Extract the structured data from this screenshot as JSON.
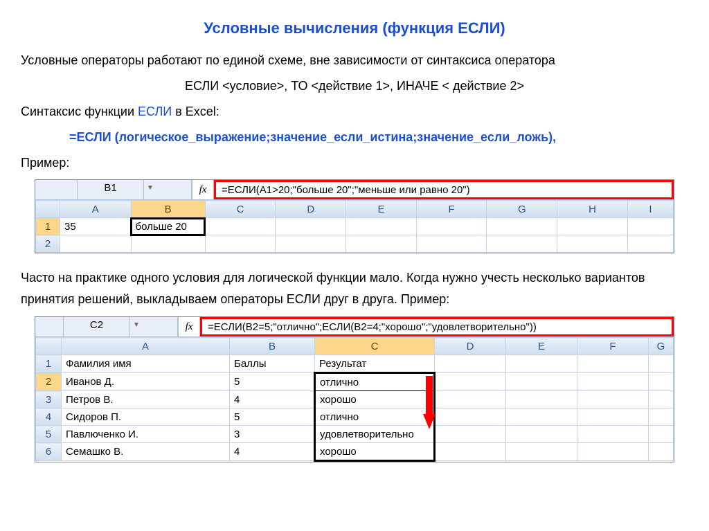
{
  "title": "Условные вычисления (функция ЕСЛИ)",
  "p1": "Условные операторы работают по единой схеме, вне зависимости от синтаксиса оператора",
  "p2": "ЕСЛИ <условие>, ТО <действие 1>, ИНАЧЕ < действие 2>",
  "p3a": "Синтаксис функции ",
  "p3b": "ЕСЛИ",
  "p3c": " в Excel:",
  "p4": "=ЕСЛИ (логическое_выражение;значение_если_истина;значение_если_ложь),",
  "p5": "Пример:",
  "p6": "Часто на практике одного условия для логической функции мало. Когда нужно учесть несколько вариантов принятия решений, выкладываем операторы ЕСЛИ друг в друга. Пример:",
  "excel1": {
    "cellref": "B1",
    "fx": "fx",
    "formula": "=ЕСЛИ(A1>20;\"больше 20\";\"меньше или равно 20\")",
    "cols": [
      "A",
      "B",
      "C",
      "D",
      "E",
      "F",
      "G",
      "H",
      "I"
    ],
    "rows": [
      {
        "n": "1",
        "A": "35",
        "B": "больше 20"
      },
      {
        "n": "2",
        "A": "",
        "B": ""
      }
    ]
  },
  "excel2": {
    "cellref": "C2",
    "fx": "fx",
    "formula": "=ЕСЛИ(B2=5;\"отлично\";ЕСЛИ(B2=4;\"хорошо\";\"удовлетворительно\"))",
    "cols": [
      "A",
      "B",
      "C",
      "D",
      "E",
      "F",
      "G"
    ],
    "header": {
      "A": "Фамилия имя",
      "B": "Баллы",
      "C": "Результат"
    },
    "rows": [
      {
        "n": "2",
        "A": "Иванов Д.",
        "B": "5",
        "C": "отлично"
      },
      {
        "n": "3",
        "A": "Петров В.",
        "B": "4",
        "C": "хорошо"
      },
      {
        "n": "4",
        "A": "Сидоров П.",
        "B": "5",
        "C": "отлично"
      },
      {
        "n": "5",
        "A": "Павлюченко И.",
        "B": "3",
        "C": "удовлетворительно"
      },
      {
        "n": "6",
        "A": "Семашко В.",
        "B": "4",
        "C": "хорошо"
      }
    ]
  }
}
